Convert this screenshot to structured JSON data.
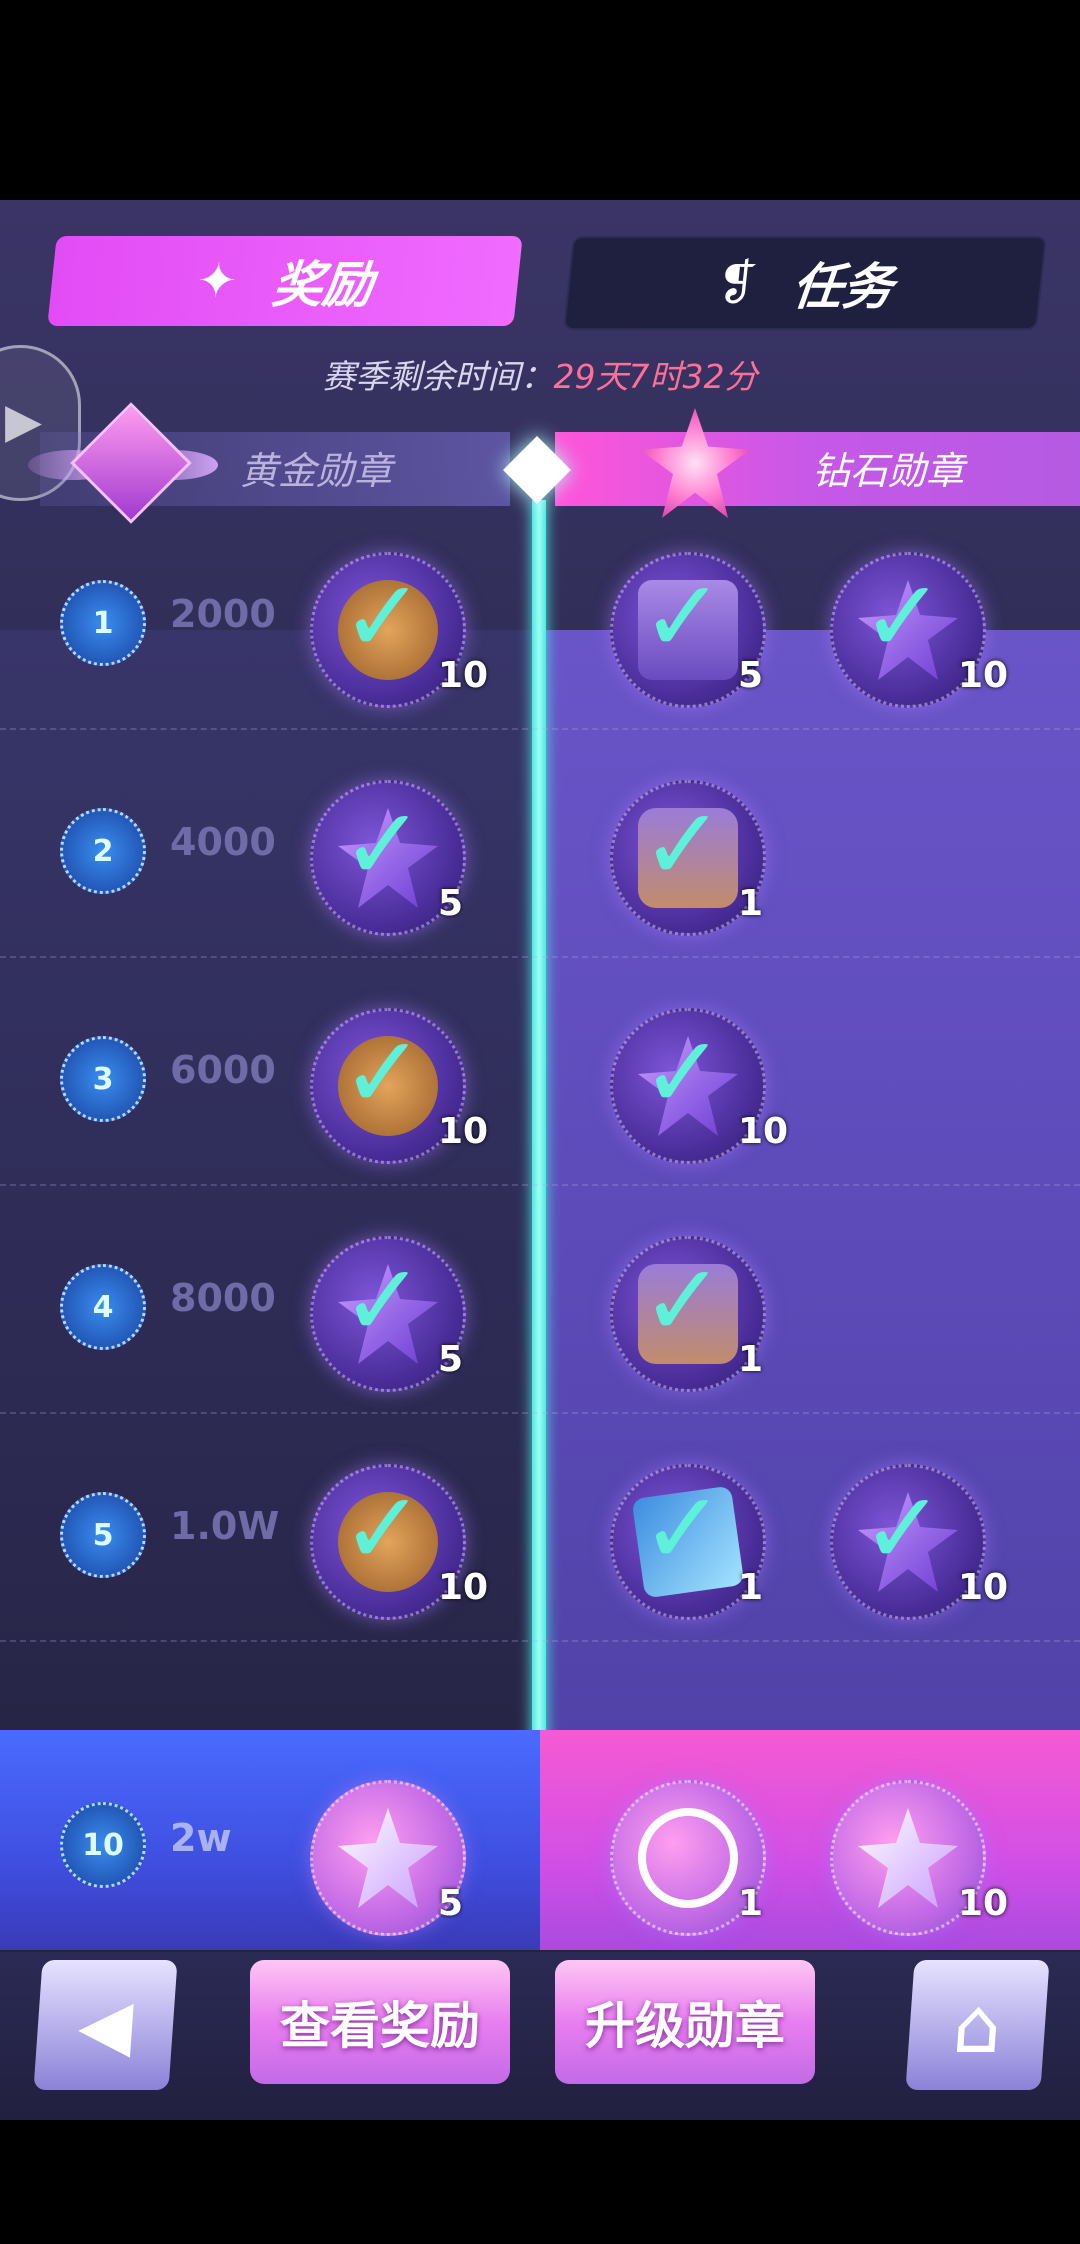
{
  "tabs": {
    "rewards_label": "奖励",
    "tasks_label": "任务"
  },
  "season": {
    "label": "赛季剩余时间：",
    "remaining": "29天7时32分"
  },
  "medals": {
    "gold_label": "黄金勋章",
    "diamond_label": "钻石勋章"
  },
  "levels": [
    {
      "level": "1",
      "score": "2000",
      "gold": {
        "item": "coin",
        "qty": "10",
        "claimed": true
      },
      "diamond": [
        {
          "item": "ticket",
          "qty": "5",
          "claimed": true
        },
        {
          "item": "star",
          "qty": "10",
          "claimed": true
        }
      ]
    },
    {
      "level": "2",
      "score": "4000",
      "gold": {
        "item": "star",
        "qty": "5",
        "claimed": true
      },
      "diamond": [
        {
          "item": "chest",
          "qty": "1",
          "claimed": true
        }
      ]
    },
    {
      "level": "3",
      "score": "6000",
      "gold": {
        "item": "coin",
        "qty": "10",
        "claimed": true
      },
      "diamond": [
        {
          "item": "star",
          "qty": "10",
          "claimed": true
        }
      ]
    },
    {
      "level": "4",
      "score": "8000",
      "gold": {
        "item": "star",
        "qty": "5",
        "claimed": true
      },
      "diamond": [
        {
          "item": "chest",
          "qty": "1",
          "claimed": true
        }
      ]
    },
    {
      "level": "5",
      "score": "1.0W",
      "gold": {
        "item": "coin",
        "qty": "10",
        "claimed": true
      },
      "diamond": [
        {
          "item": "card",
          "qty": "1",
          "claimed": true
        },
        {
          "item": "star",
          "qty": "10",
          "claimed": true
        }
      ]
    }
  ],
  "highlight_level": {
    "level": "10",
    "score": "2w",
    "gold": {
      "item": "star",
      "qty": "5"
    },
    "diamond": [
      {
        "item": "frame",
        "qty": "1"
      },
      {
        "item": "star",
        "qty": "10"
      }
    ]
  },
  "bottom": {
    "view_rewards_label": "查看奖励",
    "upgrade_label": "升级勋章"
  },
  "icons": {
    "back": "◀",
    "home": "⌂",
    "play": "▶",
    "check": "✓"
  },
  "colors": {
    "accent": "#e24cf5",
    "progress": "#4ee8e0",
    "timer": "#ff6f9a"
  }
}
